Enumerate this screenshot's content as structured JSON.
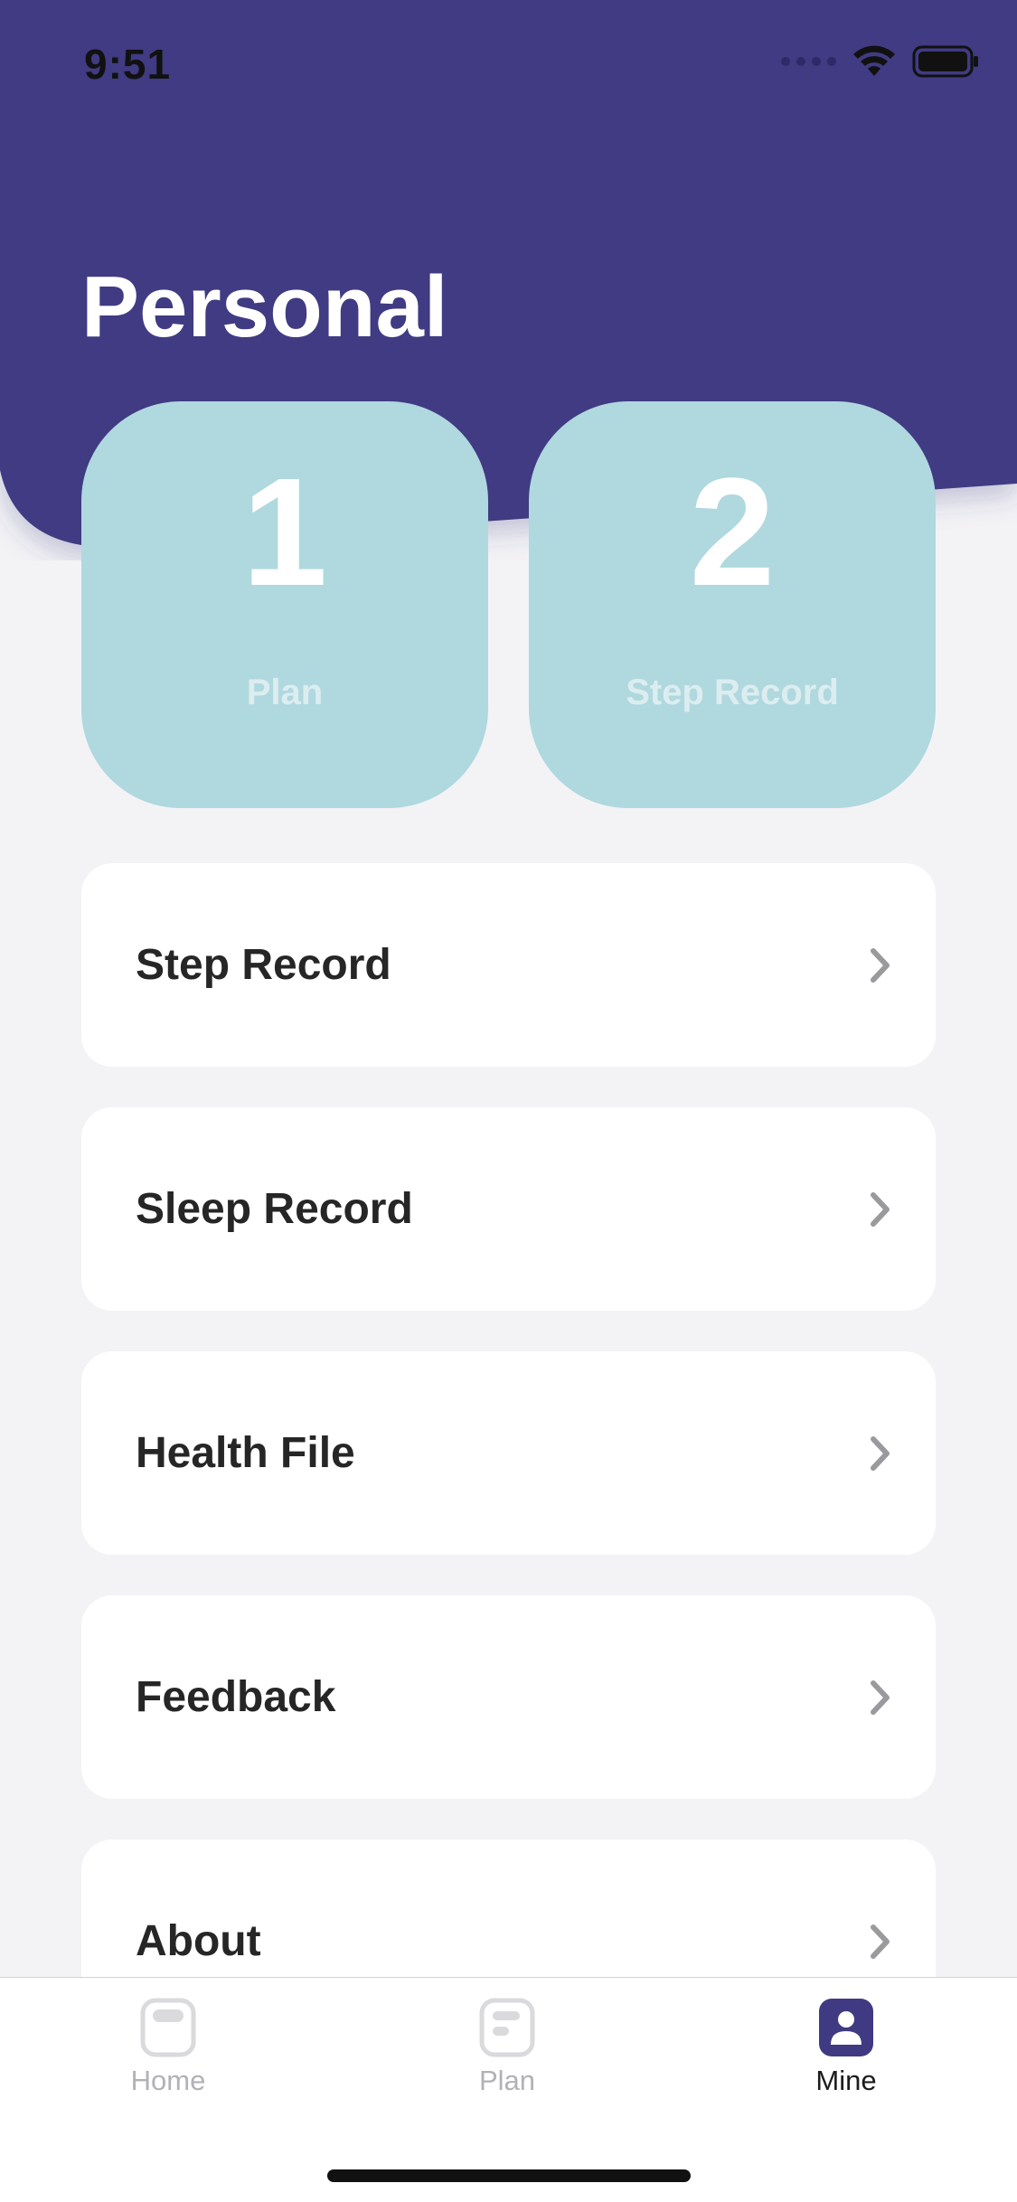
{
  "status_bar": {
    "time": "9:51"
  },
  "header": {
    "title": "Personal"
  },
  "stats": [
    {
      "value": "1",
      "label": "Plan"
    },
    {
      "value": "2",
      "label": "Step Record"
    }
  ],
  "menu": [
    {
      "label": "Step Record",
      "icon": "chevron-right-icon"
    },
    {
      "label": "Sleep Record",
      "icon": "chevron-right-icon"
    },
    {
      "label": "Health File",
      "icon": "chevron-right-icon"
    },
    {
      "label": "Feedback",
      "icon": "chevron-right-icon"
    },
    {
      "label": "About",
      "icon": "chevron-right-icon"
    }
  ],
  "tab_bar": {
    "tabs": [
      {
        "label": "Home",
        "icon": "home-tab-icon",
        "active": false
      },
      {
        "label": "Plan",
        "icon": "plan-tab-icon",
        "active": false
      },
      {
        "label": "Mine",
        "icon": "mine-tab-icon",
        "active": true
      }
    ]
  },
  "colors": {
    "header": "#3f3a82",
    "stat_card": "#b0d8df",
    "background": "#f3f3f6",
    "tab_active": "#3f3a82",
    "tab_inactive": "#b1b1b6"
  }
}
